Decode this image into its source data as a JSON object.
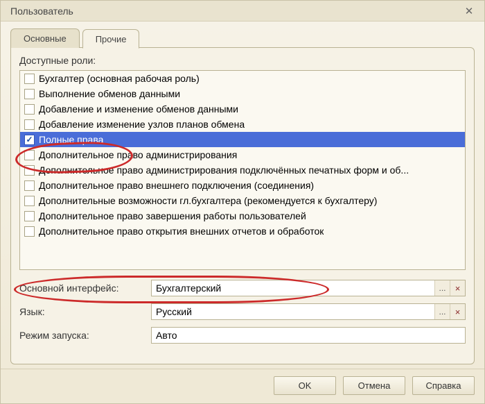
{
  "window": {
    "title": "Пользователь"
  },
  "tabs": {
    "main": "Основные",
    "other": "Прочие"
  },
  "roles": {
    "label": "Доступные роли:",
    "items": [
      {
        "label": "Бухгалтер (основная рабочая роль)",
        "checked": false,
        "selected": false
      },
      {
        "label": "Выполнение обменов данными",
        "checked": false,
        "selected": false
      },
      {
        "label": "Добавление и изменение обменов данными",
        "checked": false,
        "selected": false
      },
      {
        "label": "Добавление изменение узлов планов обмена",
        "checked": false,
        "selected": false
      },
      {
        "label": "Полные права",
        "checked": true,
        "selected": true
      },
      {
        "label": "Дополнительное право администрирования",
        "checked": false,
        "selected": false
      },
      {
        "label": "Дополнительное право администрирования подключённых печатных форм и об...",
        "checked": false,
        "selected": false
      },
      {
        "label": "Дополнительное право внешнего подключения (соединения)",
        "checked": false,
        "selected": false
      },
      {
        "label": "Дополнительные возможности гл.бухгалтера (рекомендуется к бухгалтеру)",
        "checked": false,
        "selected": false
      },
      {
        "label": "Дополнительное право завершения работы пользователей",
        "checked": false,
        "selected": false
      },
      {
        "label": "Дополнительное право открытия внешних отчетов и обработок",
        "checked": false,
        "selected": false
      }
    ]
  },
  "form": {
    "interface_label": "Основной интерфейс:",
    "interface_value": "Бухгалтерский",
    "language_label": "Язык:",
    "language_value": "Русский",
    "launch_label": "Режим запуска:",
    "launch_value": "Авто",
    "ellipsis": "...",
    "clear": "×"
  },
  "buttons": {
    "ok": "OK",
    "cancel": "Отмена",
    "help": "Справка"
  }
}
